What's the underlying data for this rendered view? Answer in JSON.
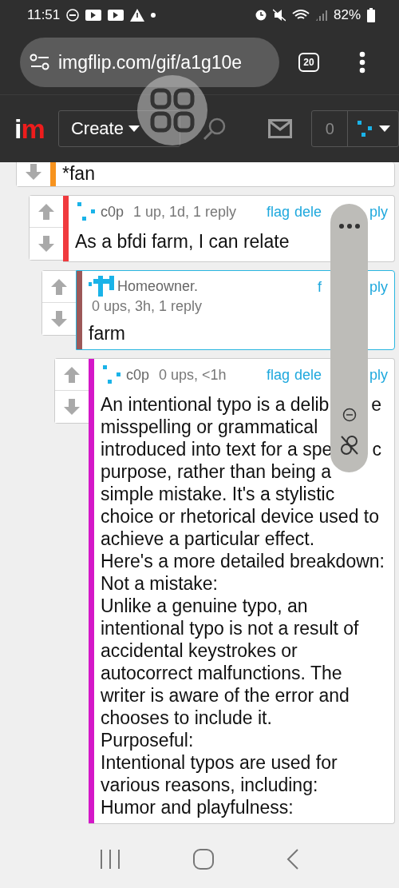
{
  "status_bar": {
    "time": "11:51",
    "battery": "82%"
  },
  "browser": {
    "url": "imgflip.com/gif/a1g10e",
    "tab_count": "20"
  },
  "site_header": {
    "logo_letters": [
      {
        "text": "i",
        "color": "#ffffff"
      },
      {
        "text": "m",
        "color": "#ee1c1c"
      }
    ],
    "create_label": "Create",
    "notification_count": "0"
  },
  "comments": [
    {
      "color": "#f7931e",
      "highlighted": false,
      "votes": [
        {
          "kind": "down"
        }
      ],
      "body_lines": [
        {
          "text": "*fan"
        }
      ],
      "children": [
        {
          "color": "#f03a3e",
          "highlighted": false,
          "votes": [
            {
              "kind": "up"
            },
            {
              "kind": "down"
            }
          ],
          "avatar": {
            "kind": "dots"
          },
          "author": "c0p",
          "meta": "1 up, 1d, 1 reply",
          "links": [
            "flag",
            "dele",
            "ply"
          ],
          "body_lines": [
            {
              "text": "As a bfdi farm, I can relate"
            }
          ],
          "children": [
            {
              "color": "#9c5858",
              "highlighted": true,
              "votes": [
                {
                  "kind": "up"
                },
                {
                  "kind": "down"
                }
              ],
              "avatar": {
                "kind": "tee"
              },
              "author": "Homeowner.",
              "meta": "0 ups, 3h, 1 reply",
              "links": [
                "f",
                "ply"
              ],
              "body_lines": [
                {
                  "text": "farm"
                }
              ],
              "children": [
                {
                  "color": "#d417c8",
                  "highlighted": false,
                  "votes": [
                    {
                      "kind": "up"
                    },
                    {
                      "kind": "down"
                    }
                  ],
                  "avatar": {
                    "kind": "dots"
                  },
                  "author": "c0p",
                  "meta": "0 ups, <1h",
                  "links": [
                    "flag",
                    "dele",
                    "ply"
                  ],
                  "body_lines": [
                    {
                      "text": "An intentional typo is a delib",
                      "right": "e"
                    },
                    {
                      "text": "misspelling or grammatical"
                    },
                    {
                      "text": "introduced into text for a spe",
                      "right": "c"
                    },
                    {
                      "text": "purpose, rather than being a"
                    },
                    {
                      "text": "simple mistake. It's a stylistic"
                    },
                    {
                      "text": "choice or rhetorical device used to"
                    },
                    {
                      "text": "achieve a particular effect."
                    },
                    {
                      "text": "Here's a more detailed breakdown:"
                    },
                    {
                      "text": "Not a mistake:"
                    },
                    {
                      "text": "Unlike a genuine typo, an"
                    },
                    {
                      "text": "intentional typo is not a result of"
                    },
                    {
                      "text": "accidental keystrokes or"
                    },
                    {
                      "text": "autocorrect malfunctions. The"
                    },
                    {
                      "text": "writer is aware of the error and"
                    },
                    {
                      "text": "chooses to include it."
                    },
                    {
                      "text": "Purposeful:"
                    },
                    {
                      "text": "Intentional typos are used for"
                    },
                    {
                      "text": "various reasons, including:"
                    },
                    {
                      "text": "Humor and playfulness:"
                    }
                  ]
                }
              ]
            }
          ]
        }
      ]
    }
  ]
}
